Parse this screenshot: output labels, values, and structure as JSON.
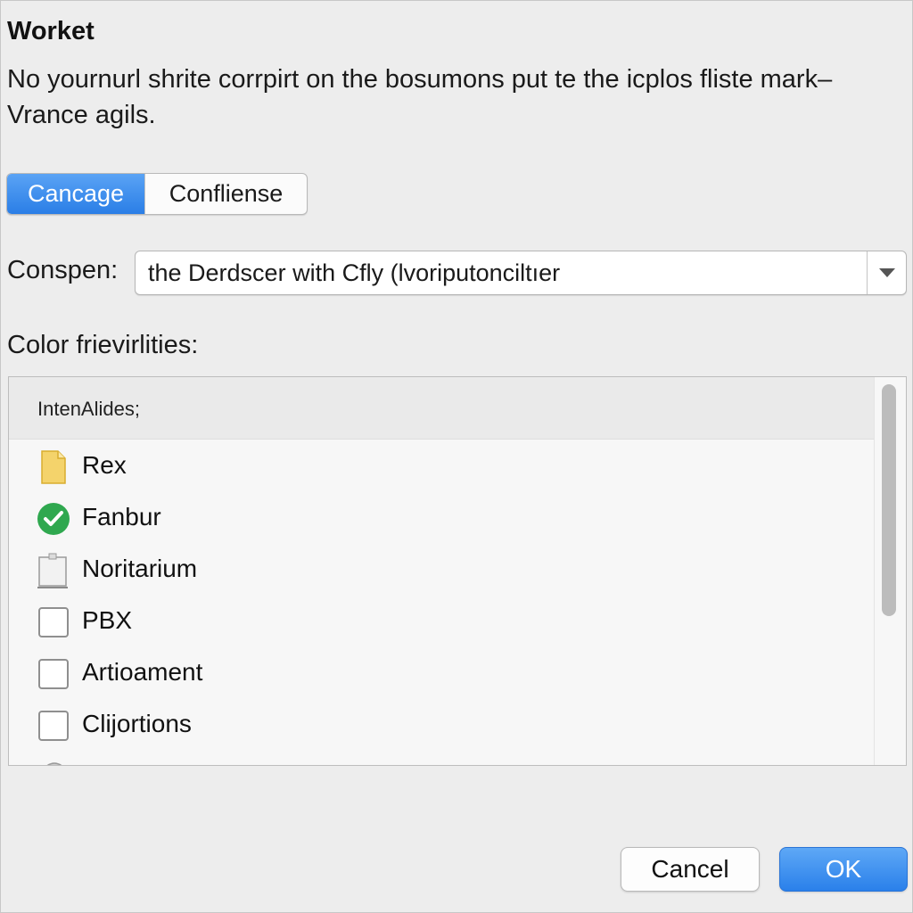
{
  "dialog": {
    "title": "Worket",
    "message": "No yournurl shrite corrpirt on the bosumons put te the icplos fliste mark–Vrance agils."
  },
  "segmented": {
    "options": [
      {
        "label": "Cancage",
        "selected": true
      },
      {
        "label": "Confliense",
        "selected": false
      }
    ]
  },
  "popup": {
    "label": "Conspen:",
    "value": "the Derdscer with  Cfly (lvoriputonciltıer"
  },
  "list": {
    "label": "Color frievirlities:",
    "header": "IntenAlides;",
    "items": [
      {
        "label": "Rex",
        "icon": "folder-icon"
      },
      {
        "label": "Fanbur",
        "icon": "checkmark-circle-icon"
      },
      {
        "label": "Noritarium",
        "icon": "document-icon"
      },
      {
        "label": "PBX",
        "icon": "checkbox-icon"
      },
      {
        "label": "Artioament",
        "icon": "checkbox-icon"
      },
      {
        "label": "Clijortions",
        "icon": "checkbox-icon"
      }
    ]
  },
  "buttons": {
    "cancel": "Cancel",
    "ok": "OK"
  },
  "colors": {
    "accent": "#2a7ee6",
    "check_green": "#2fa84f",
    "folder_yellow": "#f2cf5b"
  }
}
